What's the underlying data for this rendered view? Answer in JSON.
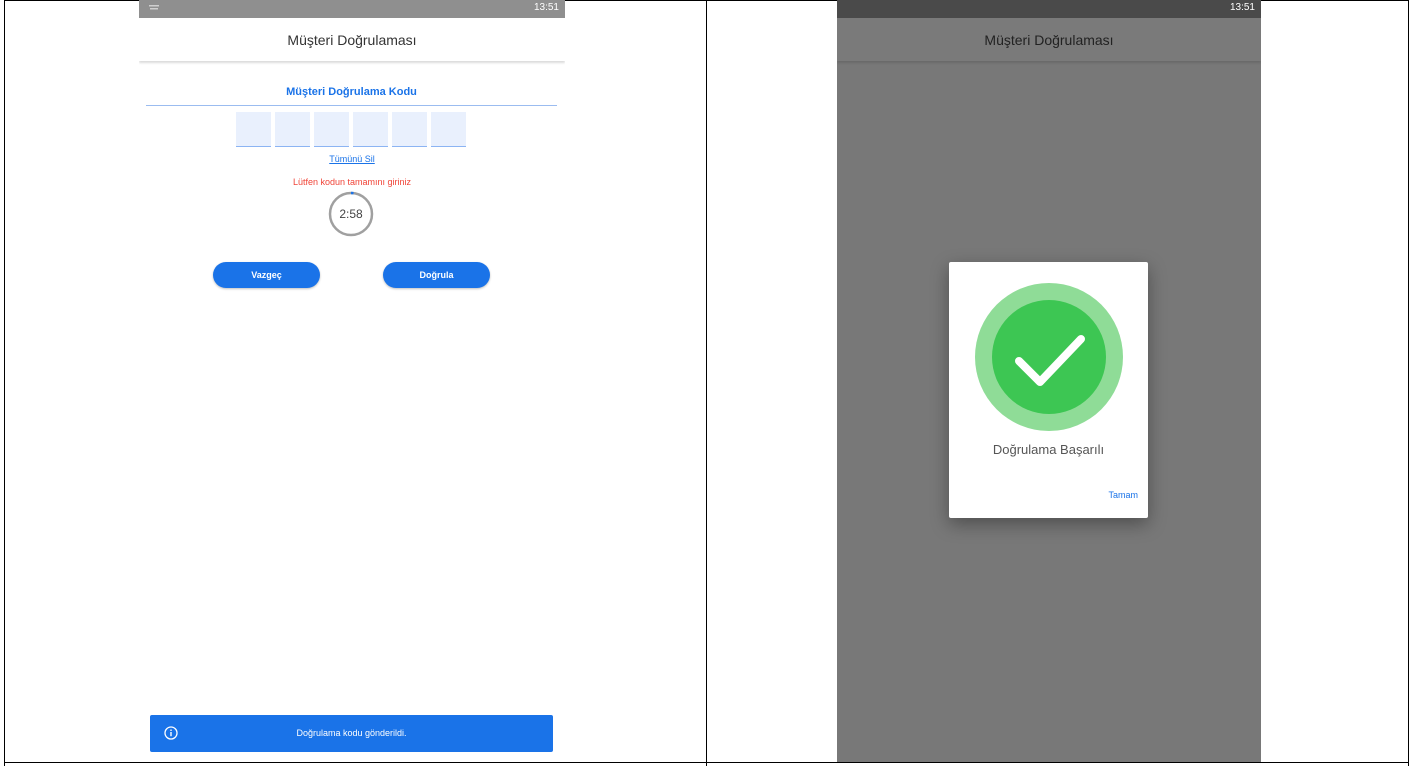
{
  "left_screen": {
    "status_time": "13:51",
    "app_title": "Müşteri Doğrulaması",
    "code_heading": "Müşteri Doğrulama Kodu",
    "code_digits": [
      "",
      "",
      "",
      "",
      "",
      ""
    ],
    "clear_all_label": "Tümünü Sil",
    "error_message": "Lütfen kodun tamamını giriniz",
    "timer_text": "2:58",
    "cancel_label": "Vazgeç",
    "verify_label": "Doğrula",
    "snackbar_message": "Doğrulama kodu gönderildi.",
    "snackbar_icon": "info-icon"
  },
  "right_screen": {
    "status_time": "13:51",
    "app_title": "Müşteri Doğrulaması",
    "dialog_icon": "check-circle-icon",
    "dialog_message": "Doğrulama Başarılı",
    "ok_label": "Tamam"
  },
  "colors": {
    "primary": "#1a73e8",
    "error": "#f04438",
    "success": "#3dc653",
    "success_halo": "#8fdc97"
  }
}
